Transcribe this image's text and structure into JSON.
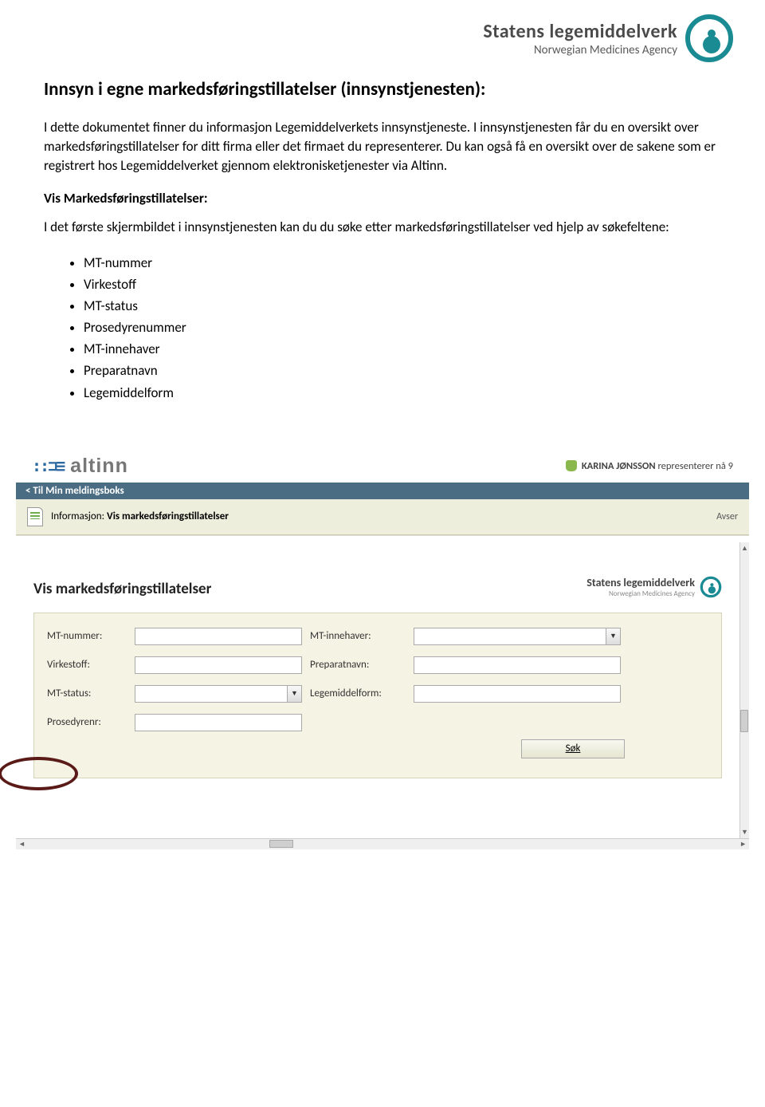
{
  "agency": {
    "title": "Statens legemiddelverk",
    "subtitle": "Norwegian Medicines Agency"
  },
  "doc": {
    "title": "Innsyn i egne markedsføringstillatelser (innsynstjenesten):",
    "p1": "I dette dokumentet finner du informasjon Legemiddelverkets innsynstjeneste. I innsynstjenesten får du en oversikt over markedsføringstillatelser for ditt firma eller det firmaet du representerer. Du kan også få en oversikt over de sakene som er registrert hos Legemiddelverket gjennom elektronisketjenester via Altinn.",
    "section_heading": "Vis Markedsføringstillatelser:",
    "p2": "I det første skjermbildet i innsynstjenesten kan du du søke etter markedsføringstillatelser ved hjelp av søkefeltene:",
    "bullets": [
      "MT-nummer",
      "Virkestoff",
      "MT-status",
      "Prosedyrenummer",
      "MT-innehaver",
      "Preparatnavn",
      "Legemiddelform"
    ]
  },
  "embed": {
    "altinn_brand": "altinn",
    "user_name": "KARINA JØNSSON",
    "user_suffix": "representerer nå 9",
    "nav_back": "< Til Min meldingsboks",
    "info_prefix": "Informasjon:",
    "info_title": "Vis markedsføringstillatelser",
    "info_right": "Avser",
    "form_title": "Vis markedsføringstillatelser",
    "agency_mini_title": "Statens legemiddelverk",
    "agency_mini_sub": "Norwegian Medicines Agency",
    "labels": {
      "mt_nummer": "MT-nummer:",
      "mt_innehaver": "MT-innehaver:",
      "virkestoff": "Virkestoff:",
      "preparatnavn": "Preparatnavn:",
      "mt_status": "MT-status:",
      "legemiddelform": "Legemiddelform:",
      "prosedyrenr": "Prosedyrenr:"
    },
    "search_btn": "Søk"
  }
}
